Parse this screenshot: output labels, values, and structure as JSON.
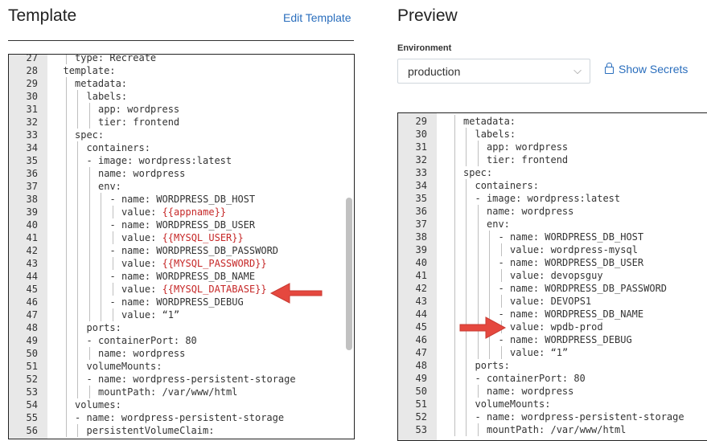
{
  "template_panel": {
    "title": "Template",
    "edit_link": "Edit Template",
    "lines": [
      {
        "n": "27",
        "indent": 2,
        "parts": [
          {
            "t": "type: Recreate"
          }
        ]
      },
      {
        "n": "28",
        "indent": 1,
        "parts": [
          {
            "t": "template:"
          }
        ]
      },
      {
        "n": "29",
        "indent": 2,
        "parts": [
          {
            "t": "metadata:"
          }
        ]
      },
      {
        "n": "30",
        "indent": 3,
        "parts": [
          {
            "t": "labels:"
          }
        ]
      },
      {
        "n": "31",
        "indent": 4,
        "parts": [
          {
            "t": "app: wordpress"
          }
        ]
      },
      {
        "n": "32",
        "indent": 4,
        "parts": [
          {
            "t": "tier: frontend"
          }
        ]
      },
      {
        "n": "33",
        "indent": 2,
        "parts": [
          {
            "t": "spec:"
          }
        ]
      },
      {
        "n": "34",
        "indent": 3,
        "parts": [
          {
            "t": "containers:"
          }
        ]
      },
      {
        "n": "35",
        "indent": 3,
        "parts": [
          {
            "t": "- image: wordpress:latest"
          }
        ]
      },
      {
        "n": "36",
        "indent": 4,
        "parts": [
          {
            "t": "name: wordpress"
          }
        ]
      },
      {
        "n": "37",
        "indent": 4,
        "parts": [
          {
            "t": "env:"
          }
        ]
      },
      {
        "n": "38",
        "indent": 5,
        "parts": [
          {
            "t": "- name: WORDPRESS_DB_HOST"
          }
        ]
      },
      {
        "n": "39",
        "indent": 6,
        "parts": [
          {
            "t": "value: "
          },
          {
            "t": "{{appname}}",
            "tpl": true
          }
        ]
      },
      {
        "n": "40",
        "indent": 5,
        "parts": [
          {
            "t": "- name: WORDPRESS_DB_USER"
          }
        ]
      },
      {
        "n": "41",
        "indent": 6,
        "parts": [
          {
            "t": "value: "
          },
          {
            "t": "{{MYSQL_USER}}",
            "tpl": true
          }
        ]
      },
      {
        "n": "42",
        "indent": 5,
        "parts": [
          {
            "t": "- name: WORDPRESS_DB_PASSWORD"
          }
        ]
      },
      {
        "n": "43",
        "indent": 6,
        "parts": [
          {
            "t": "value: "
          },
          {
            "t": "{{MYSQL_PASSWORD}}",
            "tpl": true
          }
        ]
      },
      {
        "n": "44",
        "indent": 5,
        "parts": [
          {
            "t": "- name: WORDPRESS_DB_NAME"
          }
        ]
      },
      {
        "n": "45",
        "indent": 6,
        "parts": [
          {
            "t": "value: "
          },
          {
            "t": "{{MYSQL_DATABASE}}",
            "tpl": true
          }
        ]
      },
      {
        "n": "46",
        "indent": 5,
        "parts": [
          {
            "t": "- name: WORDPRESS_DEBUG"
          }
        ]
      },
      {
        "n": "47",
        "indent": 6,
        "parts": [
          {
            "t": "value: “1”"
          }
        ]
      },
      {
        "n": "48",
        "indent": 3,
        "parts": [
          {
            "t": "ports:"
          }
        ]
      },
      {
        "n": "49",
        "indent": 3,
        "parts": [
          {
            "t": "- containerPort: 80"
          }
        ]
      },
      {
        "n": "50",
        "indent": 4,
        "parts": [
          {
            "t": "name: wordpress"
          }
        ]
      },
      {
        "n": "51",
        "indent": 3,
        "parts": [
          {
            "t": "volumeMounts:"
          }
        ]
      },
      {
        "n": "52",
        "indent": 3,
        "parts": [
          {
            "t": "- name: wordpress-persistent-storage"
          }
        ]
      },
      {
        "n": "53",
        "indent": 4,
        "parts": [
          {
            "t": "mountPath: /var/www/html"
          }
        ]
      },
      {
        "n": "54",
        "indent": 2,
        "parts": [
          {
            "t": "volumes:"
          }
        ]
      },
      {
        "n": "55",
        "indent": 2,
        "parts": [
          {
            "t": "- name: wordpress-persistent-storage"
          }
        ]
      },
      {
        "n": "56",
        "indent": 3,
        "parts": [
          {
            "t": "persistentVolumeClaim:"
          }
        ]
      }
    ]
  },
  "preview_panel": {
    "title": "Preview",
    "environment_label": "Environment",
    "environment_value": "production",
    "show_secrets": "Show Secrets",
    "lines": [
      {
        "n": "29",
        "indent": 2,
        "parts": [
          {
            "t": "metadata:"
          }
        ]
      },
      {
        "n": "30",
        "indent": 3,
        "parts": [
          {
            "t": "labels:"
          }
        ]
      },
      {
        "n": "31",
        "indent": 4,
        "parts": [
          {
            "t": "app: wordpress"
          }
        ]
      },
      {
        "n": "32",
        "indent": 4,
        "parts": [
          {
            "t": "tier: frontend"
          }
        ]
      },
      {
        "n": "33",
        "indent": 2,
        "parts": [
          {
            "t": "spec:"
          }
        ]
      },
      {
        "n": "34",
        "indent": 3,
        "parts": [
          {
            "t": "containers:"
          }
        ]
      },
      {
        "n": "35",
        "indent": 3,
        "parts": [
          {
            "t": "- image: wordpress:latest"
          }
        ]
      },
      {
        "n": "36",
        "indent": 4,
        "parts": [
          {
            "t": "name: wordpress"
          }
        ]
      },
      {
        "n": "37",
        "indent": 4,
        "parts": [
          {
            "t": "env:"
          }
        ]
      },
      {
        "n": "38",
        "indent": 5,
        "parts": [
          {
            "t": "- name: WORDPRESS_DB_HOST"
          }
        ]
      },
      {
        "n": "39",
        "indent": 6,
        "parts": [
          {
            "t": "value: wordpress-mysql"
          }
        ]
      },
      {
        "n": "40",
        "indent": 5,
        "parts": [
          {
            "t": "- name: WORDPRESS_DB_USER"
          }
        ]
      },
      {
        "n": "41",
        "indent": 6,
        "parts": [
          {
            "t": "value: devopsguy"
          }
        ]
      },
      {
        "n": "42",
        "indent": 5,
        "parts": [
          {
            "t": "- name: WORDPRESS_DB_PASSWORD"
          }
        ]
      },
      {
        "n": "43",
        "indent": 6,
        "parts": [
          {
            "t": "value: DEVOPS1"
          }
        ]
      },
      {
        "n": "44",
        "indent": 5,
        "parts": [
          {
            "t": "- name: WORDPRESS_DB_NAME"
          }
        ]
      },
      {
        "n": "45",
        "indent": 6,
        "parts": [
          {
            "t": "value: wpdb-prod"
          }
        ]
      },
      {
        "n": "46",
        "indent": 5,
        "parts": [
          {
            "t": "- name: WORDPRESS_DEBUG"
          }
        ]
      },
      {
        "n": "47",
        "indent": 6,
        "parts": [
          {
            "t": "value: “1”"
          }
        ]
      },
      {
        "n": "48",
        "indent": 3,
        "parts": [
          {
            "t": "ports:"
          }
        ]
      },
      {
        "n": "49",
        "indent": 3,
        "parts": [
          {
            "t": "- containerPort: 80"
          }
        ]
      },
      {
        "n": "50",
        "indent": 4,
        "parts": [
          {
            "t": "name: wordpress"
          }
        ]
      },
      {
        "n": "51",
        "indent": 3,
        "parts": [
          {
            "t": "volumeMounts:"
          }
        ]
      },
      {
        "n": "52",
        "indent": 3,
        "parts": [
          {
            "t": "- name: wordpress-persistent-storage"
          }
        ]
      },
      {
        "n": "53",
        "indent": 4,
        "parts": [
          {
            "t": "mountPath: /var/www/html"
          }
        ]
      }
    ]
  },
  "colors": {
    "link": "#2a6ebd",
    "template_variable": "#c62828",
    "annotation_arrow": "#e5483f",
    "gutter": "#e8e8e8"
  },
  "icons": [
    "lock-icon",
    "chevron-down-icon",
    "annotation-arrow-icon"
  ]
}
